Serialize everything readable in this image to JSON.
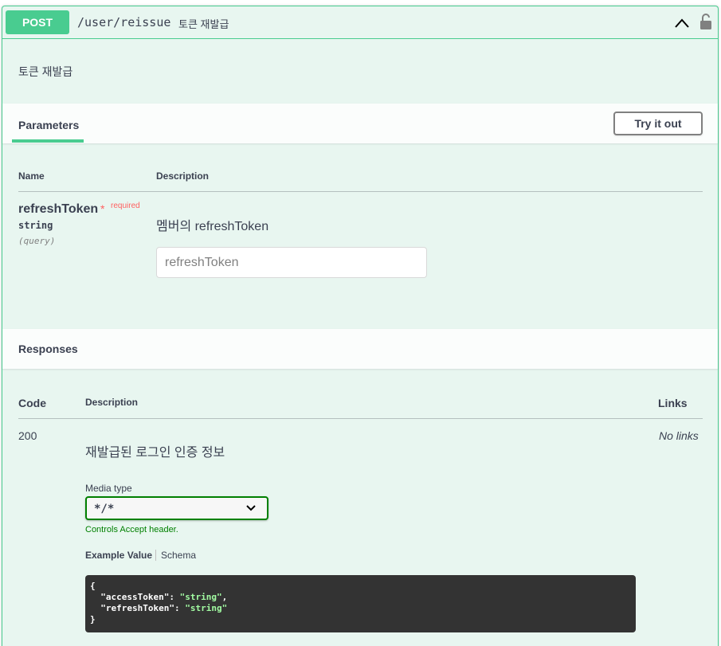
{
  "operation": {
    "method": "POST",
    "path": "/user/reissue",
    "summary": "토큰 재발급",
    "description": "토큰 재발급"
  },
  "parameters": {
    "tab_label": "Parameters",
    "try_button": "Try it out",
    "columns": {
      "name": "Name",
      "description": "Description"
    },
    "items": [
      {
        "name": "refreshToken",
        "required_star": "*",
        "required_label": "required",
        "type": "string",
        "in": "(query)",
        "description": "멤버의 refreshToken",
        "placeholder": "refreshToken"
      }
    ]
  },
  "responses": {
    "title": "Responses",
    "columns": {
      "code": "Code",
      "description": "Description",
      "links": "Links"
    },
    "items": [
      {
        "code": "200",
        "description": "재발급된 로그인 인증 정보",
        "links": "No links",
        "media_type_label": "Media type",
        "media_type_value": "*/*",
        "media_hint": "Controls Accept header.",
        "example_tab": "Example Value",
        "schema_tab": "Schema",
        "example": {
          "open": "{",
          "line1_key": "  \"accessToken\": ",
          "line1_val": "\"string\"",
          "line1_sep": ",",
          "line2_key": "  \"refreshToken\": ",
          "line2_val": "\"string\"",
          "close": "}"
        }
      }
    ]
  },
  "colors": {
    "post_green": "#49cc90",
    "background": "#e8f6f0",
    "required_red": "#ff6060",
    "select_border": "#008000"
  },
  "icons": [
    "chevron-up-icon",
    "unlock-icon",
    "chevron-down-icon"
  ]
}
